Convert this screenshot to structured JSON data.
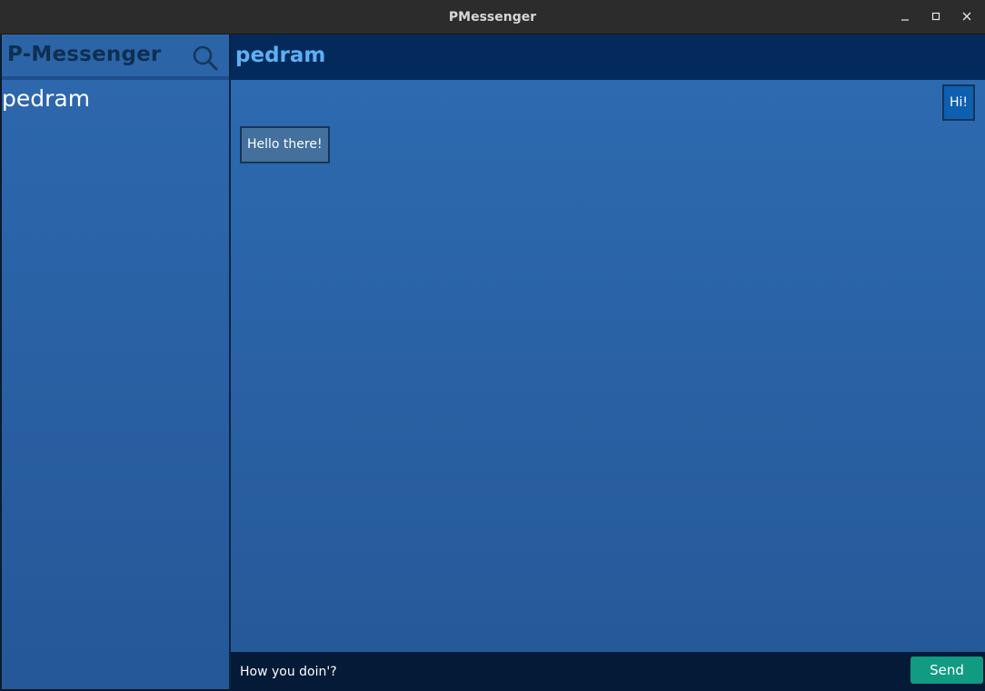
{
  "window": {
    "title": "PMessenger"
  },
  "sidebar": {
    "app_title": "P-Messenger",
    "contacts": [
      {
        "name": "pedram"
      }
    ]
  },
  "chat": {
    "contact_name": "pedram",
    "messages": [
      {
        "direction": "outgoing",
        "text": "Hi!"
      },
      {
        "direction": "incoming",
        "text": "Hello there!"
      }
    ],
    "composer": {
      "value": "How you doin'?",
      "send_label": "Send"
    }
  },
  "colors": {
    "header_bg": "#042a5c",
    "contact_name_color": "#5eb0f5",
    "send_button": "#119b82",
    "outgoing_bubble": "#0e5fb0",
    "incoming_bubble": "#43709c"
  },
  "icons": {
    "search": "search-icon",
    "minimize": "minimize-icon",
    "maximize": "maximize-icon",
    "close": "close-icon"
  }
}
